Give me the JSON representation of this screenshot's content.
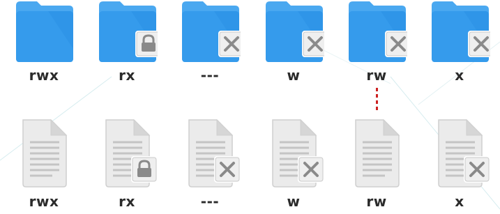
{
  "folders": [
    {
      "label": "rwx",
      "badge": "none"
    },
    {
      "label": "rx",
      "badge": "lock"
    },
    {
      "label": "---",
      "badge": "cross"
    },
    {
      "label": "w",
      "badge": "cross"
    },
    {
      "label": "rw",
      "badge": "cross"
    },
    {
      "label": "x",
      "badge": "cross"
    }
  ],
  "files": [
    {
      "label": "rwx",
      "badge": "none"
    },
    {
      "label": "rx",
      "badge": "lock"
    },
    {
      "label": "---",
      "badge": "cross"
    },
    {
      "label": "w",
      "badge": "cross"
    },
    {
      "label": "rw",
      "badge": "cross"
    },
    {
      "label": "x",
      "badge": "cross"
    }
  ],
  "colors": {
    "folder_blue": "#2f95e8",
    "folder_back": "#4aa8f0",
    "doc_gray": "#e6e6e6",
    "badge_bg": "#efefef",
    "badge_symbol": "#8a8a8a",
    "divider_red": "#cc2222",
    "label_text": "#2b2b2b"
  }
}
